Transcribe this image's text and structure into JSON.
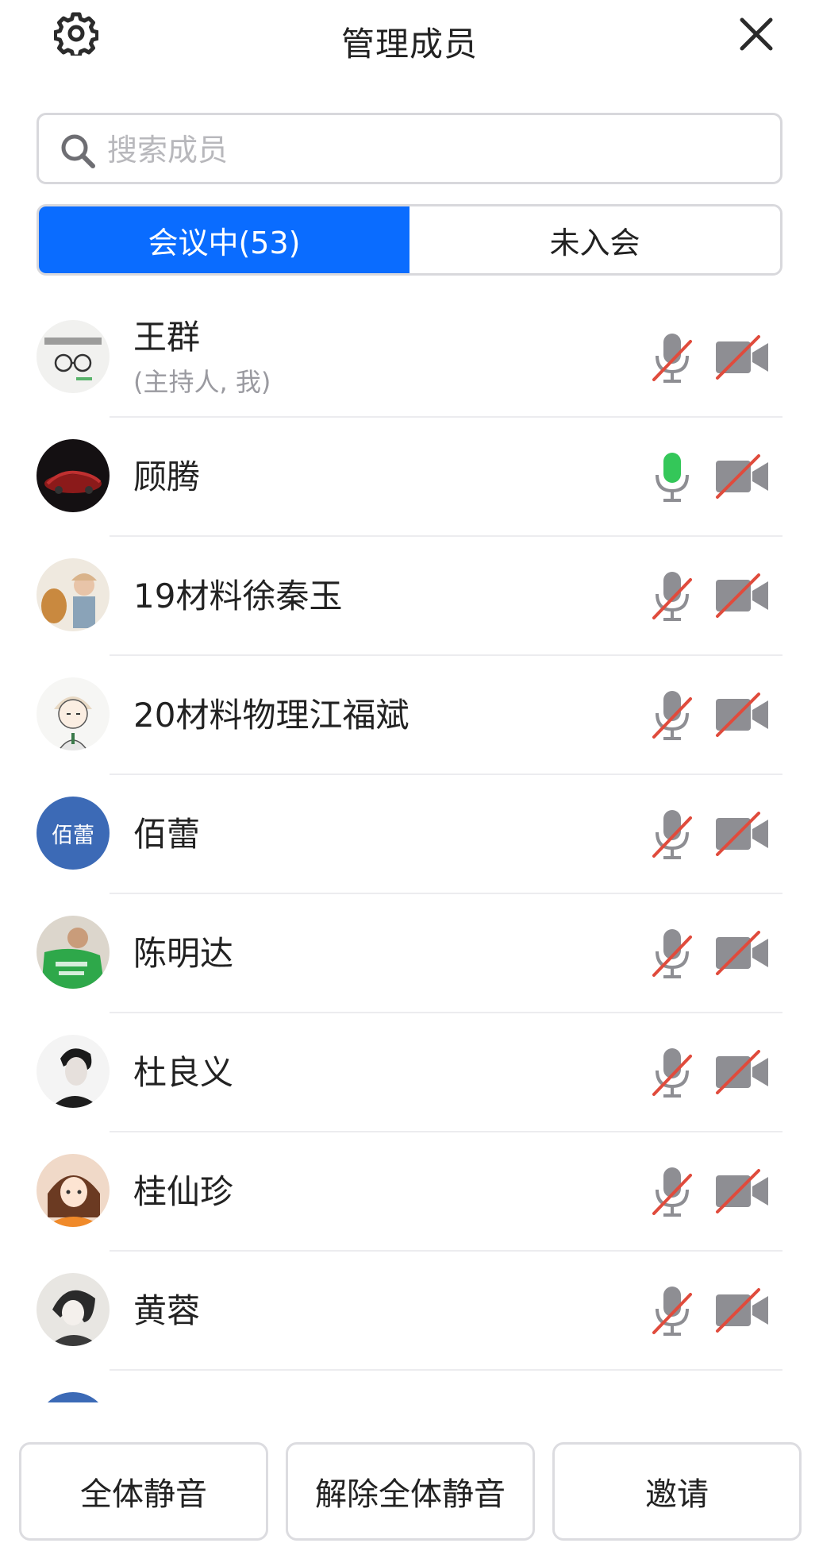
{
  "header": {
    "title": "管理成员"
  },
  "search": {
    "placeholder": "搜索成员"
  },
  "tabs": [
    {
      "label": "会议中(53)"
    },
    {
      "label": "未入会"
    }
  ],
  "members": [
    {
      "name": "王群",
      "role": "(主持人, 我)",
      "mic": "muted",
      "camera": "off",
      "avatar": "photo-glasses"
    },
    {
      "name": "顾腾",
      "mic": "active",
      "camera": "off",
      "avatar": "photo-car"
    },
    {
      "name": "19材料徐秦玉",
      "mic": "muted",
      "camera": "off",
      "avatar": "photo-girl-dog"
    },
    {
      "name": "20材料物理江福斌",
      "mic": "muted",
      "camera": "off",
      "avatar": "cartoon-boy"
    },
    {
      "name": "佰蕾",
      "avatar_text": "佰蕾",
      "mic": "muted",
      "camera": "off",
      "avatar": "initials"
    },
    {
      "name": "陈明达",
      "mic": "muted",
      "camera": "off",
      "avatar": "photo-green-shirt"
    },
    {
      "name": "杜良义",
      "mic": "muted",
      "camera": "off",
      "avatar": "photo-bw-man"
    },
    {
      "name": "桂仙珍",
      "mic": "muted",
      "camera": "off",
      "avatar": "cartoon-girl"
    },
    {
      "name": "黄蓉",
      "mic": "muted",
      "camera": "off",
      "avatar": "sketch-woman"
    }
  ],
  "actions": {
    "mute_all": "全体静音",
    "unmute_all": "解除全体静音",
    "invite": "邀请"
  },
  "colors": {
    "accent": "#0a6cff",
    "mic_active": "#34c759",
    "muted_slash": "#e04b3c",
    "icon_gray": "#8e8e93"
  }
}
